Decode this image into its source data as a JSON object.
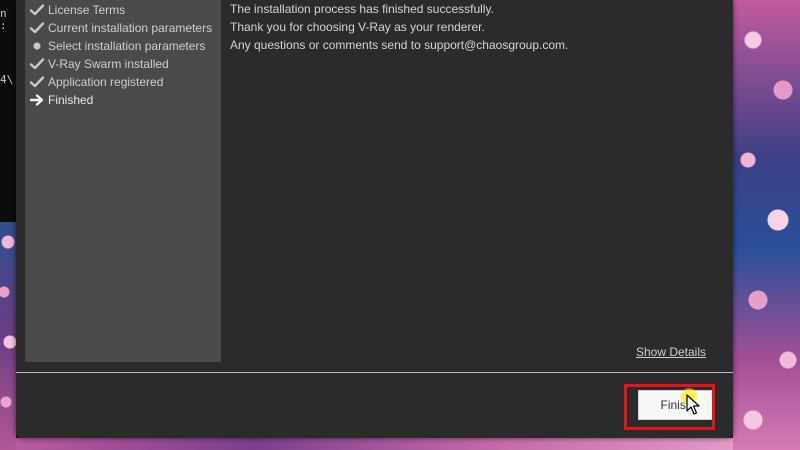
{
  "desktop": {
    "console_lines": [
      "n :",
      "",
      "",
      "",
      "4\\"
    ]
  },
  "installer": {
    "steps": [
      {
        "label": "License Terms",
        "status": "done",
        "icon": "checkmark-icon"
      },
      {
        "label": "Current installation parameters",
        "status": "done",
        "icon": "checkmark-icon"
      },
      {
        "label": "Select installation parameters",
        "status": "skipped",
        "icon": "bullet-icon"
      },
      {
        "label": "V-Ray Swarm installed",
        "status": "done",
        "icon": "checkmark-icon"
      },
      {
        "label": "Application registered",
        "status": "done",
        "icon": "checkmark-icon"
      },
      {
        "label": "Finished",
        "status": "current",
        "icon": "arrow-right-icon"
      }
    ],
    "messages": [
      "The installation process has finished successfully.",
      "Thank you for choosing V-Ray as your renderer.",
      "Any questions or comments send to support@chaosgroup.com."
    ],
    "show_details_label": "Show Details",
    "finish_label": "Finish"
  },
  "colors": {
    "window_bg": "#2b2b2b",
    "panel_bg": "#4a4a4a",
    "highlight": "#e0161b",
    "cursor_halo": "#ffec3c"
  }
}
